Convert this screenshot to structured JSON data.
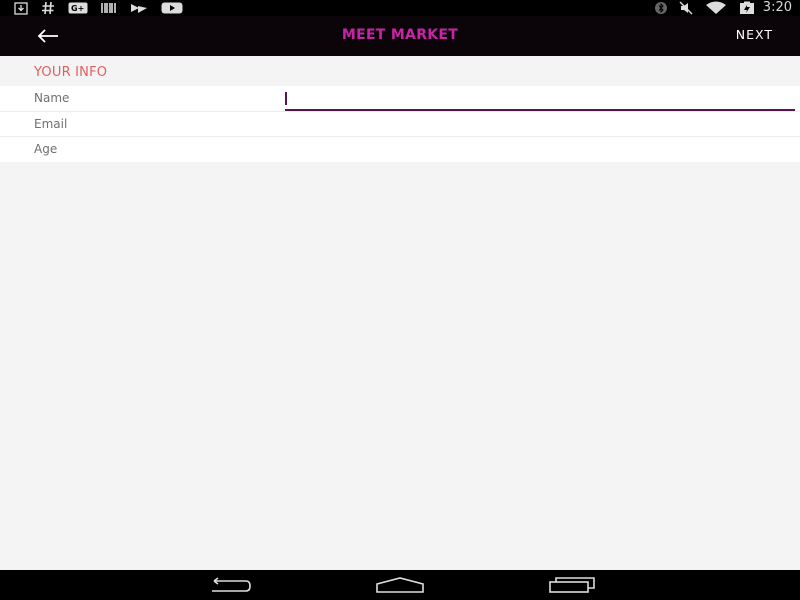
{
  "status_bar": {
    "left_icons": [
      "download-icon",
      "hashtag-icon",
      "google-plus-icon",
      "barcode-icon",
      "fast-forward-icon",
      "youtube-icon"
    ],
    "right_icons": [
      "bluetooth-icon",
      "mute-icon",
      "wifi-icon",
      "battery-icon"
    ],
    "time": "3:20"
  },
  "app_bar": {
    "title": "MEET MARKET",
    "next_label": "NEXT",
    "title_color": "#cc22aa"
  },
  "form": {
    "section_title": "YOUR INFO",
    "fields": [
      {
        "label": "Name",
        "value": "",
        "focused": true
      },
      {
        "label": "Email",
        "value": ""
      },
      {
        "label": "Age",
        "value": ""
      }
    ]
  },
  "colors": {
    "accent": "#5a1448",
    "section_header": "#e06060",
    "background": "#f4f4f4"
  },
  "nav_bar": {
    "buttons": [
      "back-icon",
      "home-icon",
      "recent-apps-icon"
    ]
  }
}
